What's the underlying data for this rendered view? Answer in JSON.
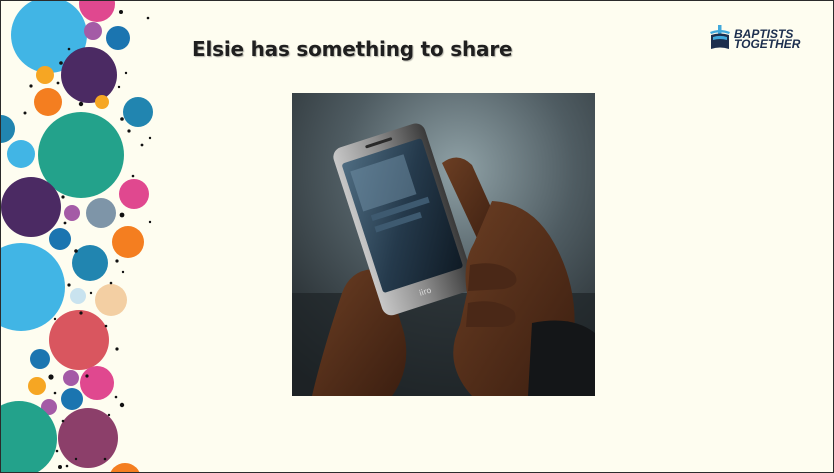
{
  "slide": {
    "title": "Elsie has something to share"
  },
  "logo": {
    "line1": "BAPTISTS",
    "line2": "TOGETHER",
    "color": "#1d2f4e",
    "accent": "#41a9dc"
  },
  "photo": {
    "icon": "photo-hands-holding-smartphone",
    "phone_brand": "iiro"
  },
  "colors": {
    "background": "#fefdf0",
    "title_text": "#1f1f1f",
    "dot_palette": [
      "#41b5e5",
      "#e0488f",
      "#4b2a63",
      "#f47e20",
      "#23a28b",
      "#2185b0",
      "#f3cfa3",
      "#d9565f"
    ]
  }
}
